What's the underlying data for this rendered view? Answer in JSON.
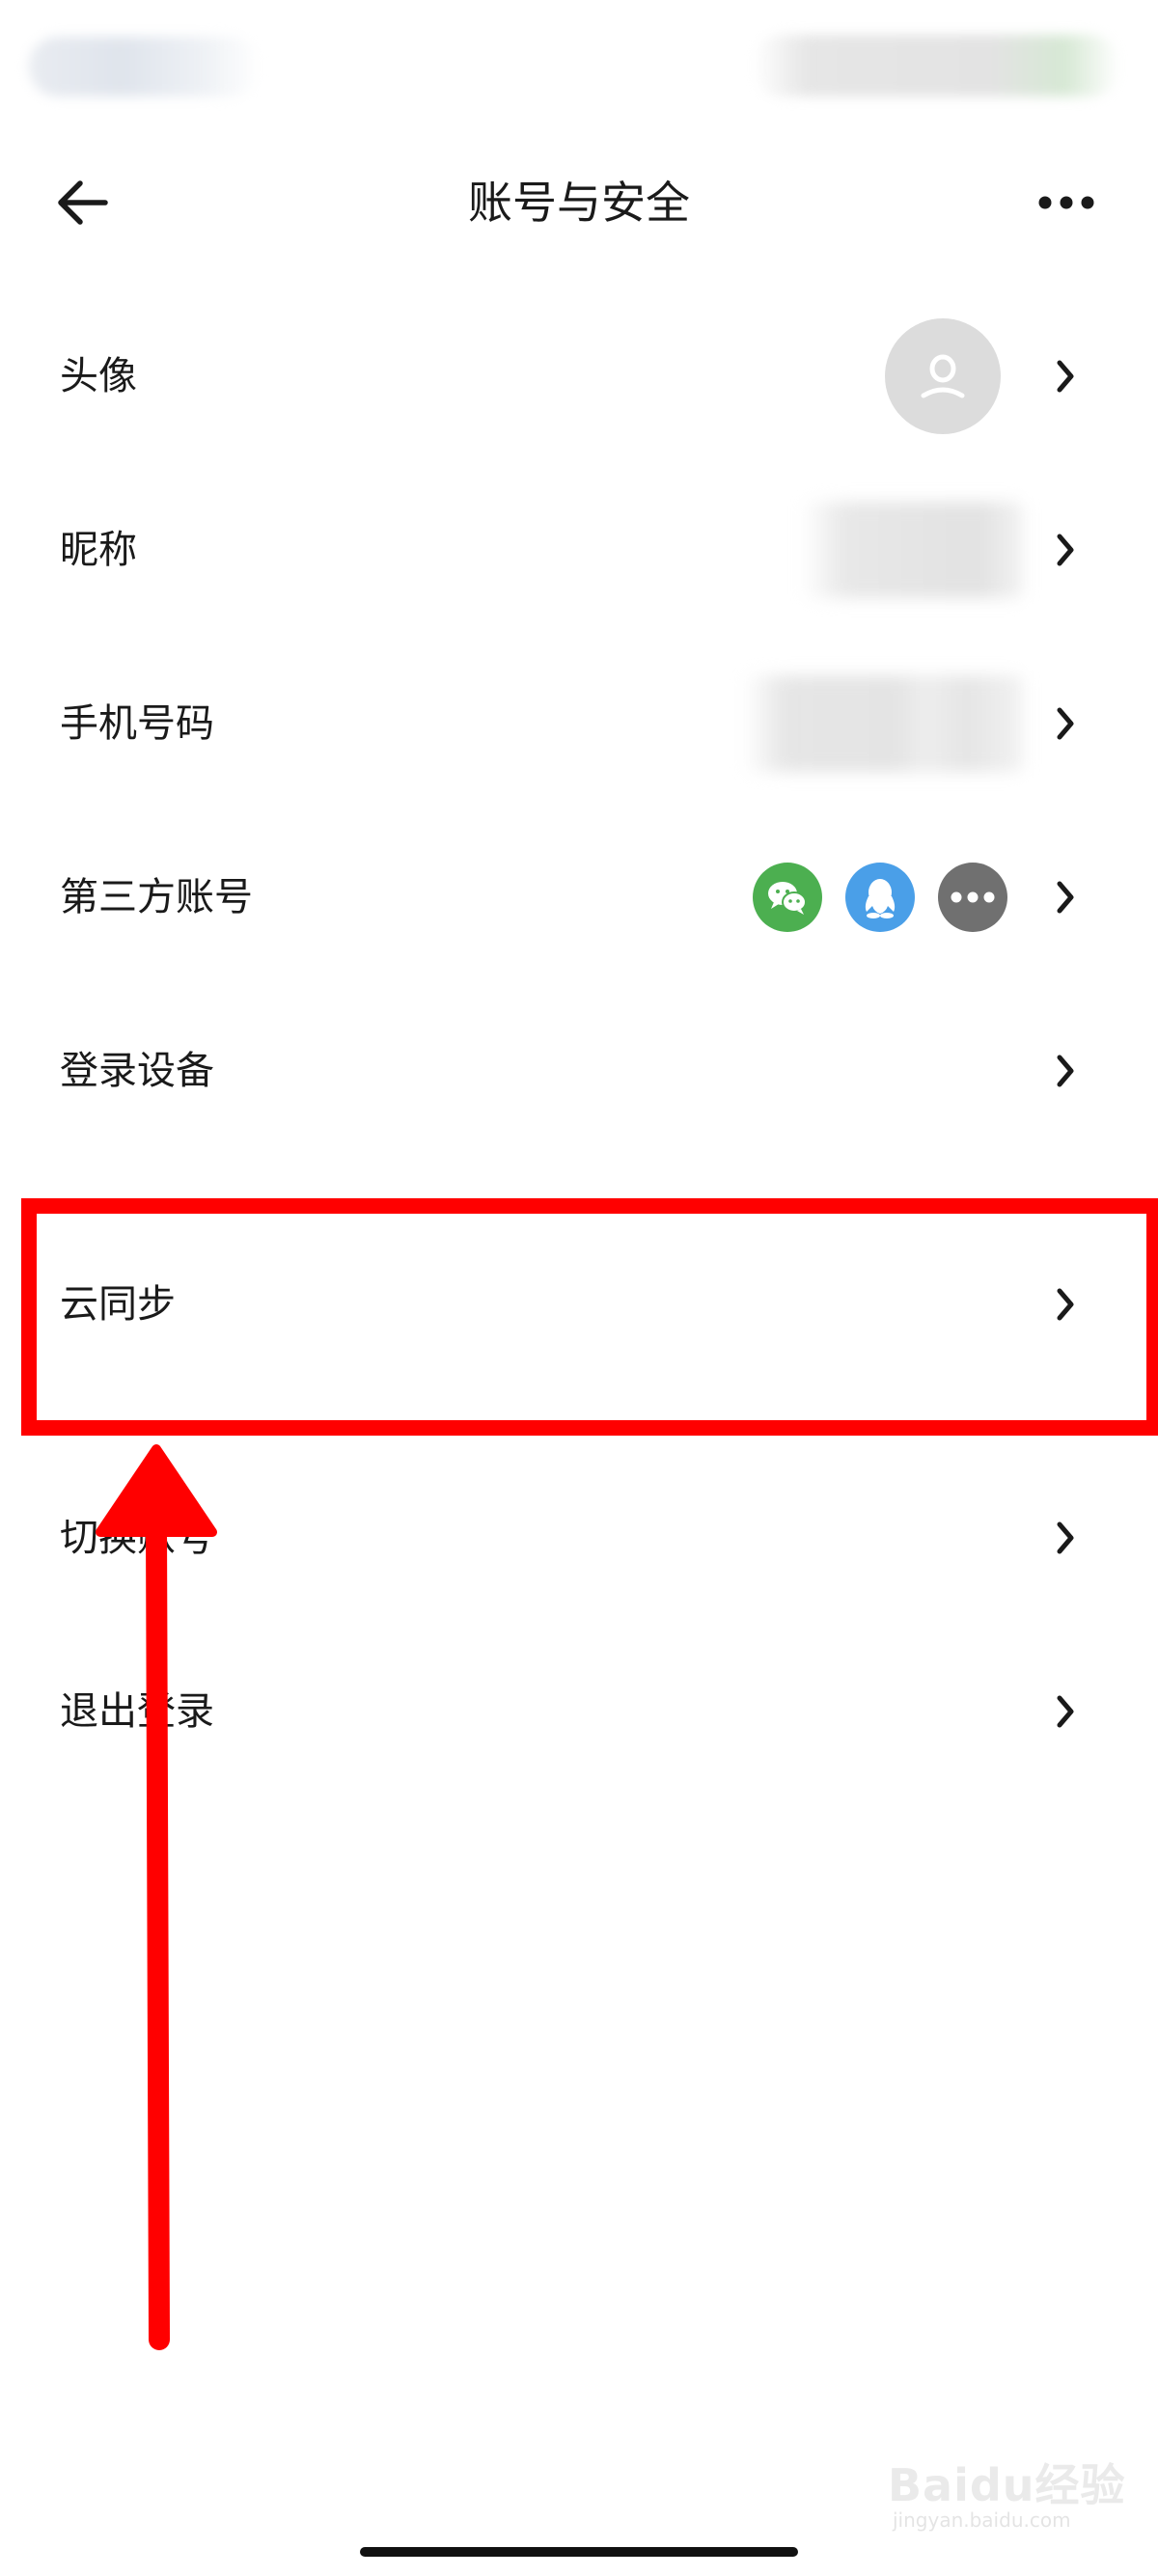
{
  "nav": {
    "title": "账号与安全",
    "back_icon": "arrow-left-icon",
    "more_icon": "more-horizontal-icon"
  },
  "rows": [
    {
      "label": "头像"
    },
    {
      "label": "昵称"
    },
    {
      "label": "手机号码"
    },
    {
      "label": "第三方账号"
    },
    {
      "label": "登录设备"
    },
    {
      "label": "云同步"
    },
    {
      "label": "切换账号"
    },
    {
      "label": "退出登录"
    }
  ],
  "third_party_icons": [
    "wechat-icon",
    "qq-icon",
    "more-accounts-icon"
  ],
  "colors": {
    "wechat": "#4caf50",
    "qq": "#4a9fe8",
    "more": "#707070",
    "highlight": "#ff0000",
    "avatar_bg": "#dcdcdc"
  },
  "watermark": {
    "main": "Baidu经验",
    "sub": "jingyan.baidu.com"
  }
}
